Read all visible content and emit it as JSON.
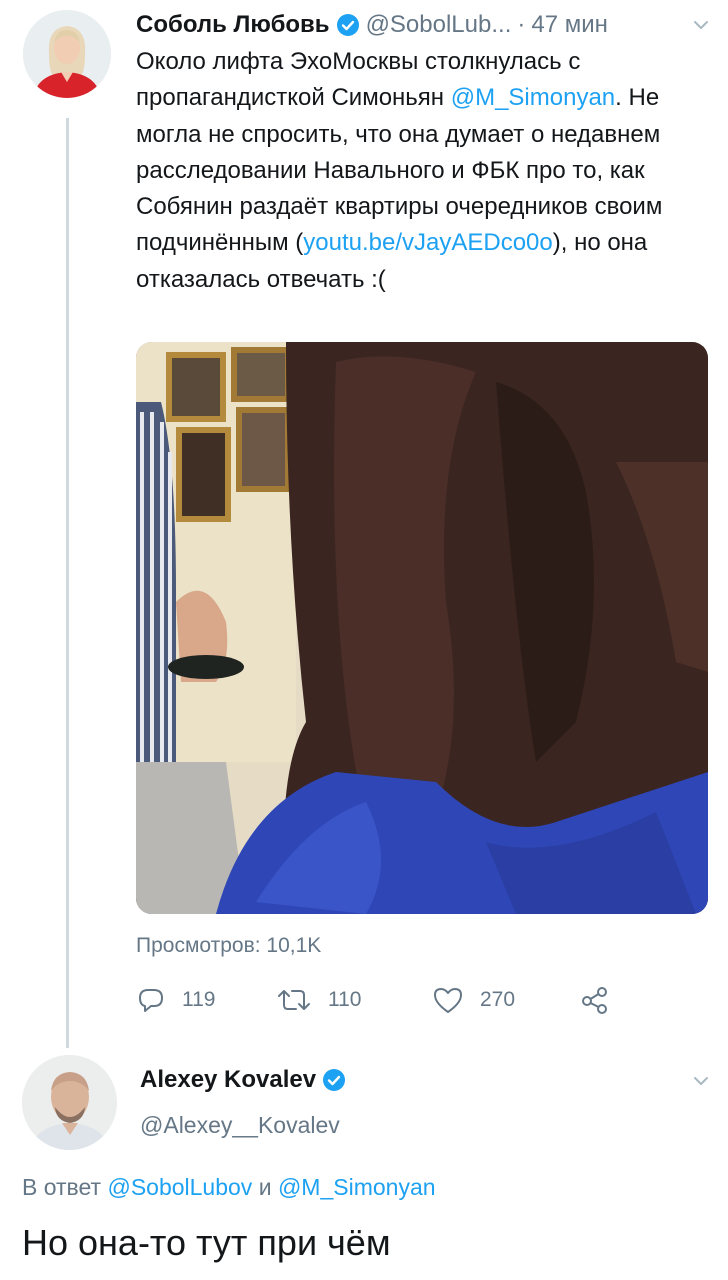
{
  "colors": {
    "link": "#1da1f2",
    "secondary": "#657786",
    "text": "#14171a",
    "verified": "#1da1f2",
    "thread_line": "#cfd9de"
  },
  "tweet1": {
    "author_name": "Соболь Любовь",
    "handle": "@SobolLub...",
    "separator": "·",
    "time": "47 мин",
    "text_part1": "Около лифта ЭхоМосквы столкнулась с пропагандисткой Симоньян ",
    "mention": "@M_Simonyan",
    "text_part2": ". Не могла не спросить, что она думает о недавнем расследовании Навального и ФБК про то, как Собянин раздаёт квартиры очередников своим подчинённым (",
    "url": "youtu.be/vJayAEDco0o",
    "text_part3": "), но она отказалась отвечать :(",
    "views": "Просмотров: 10,1K",
    "actions": {
      "reply_count": "119",
      "retweet_count": "110",
      "like_count": "270"
    }
  },
  "tweet2": {
    "author_name": "Alexey Kovalev",
    "handle": "@Alexey__Kovalev",
    "reply_prefix": "В ответ ",
    "reply_to_1": "@SobolLubov",
    "reply_conj": " и ",
    "reply_to_2": "@M_Simonyan",
    "text": "Но она-то тут при чём"
  }
}
